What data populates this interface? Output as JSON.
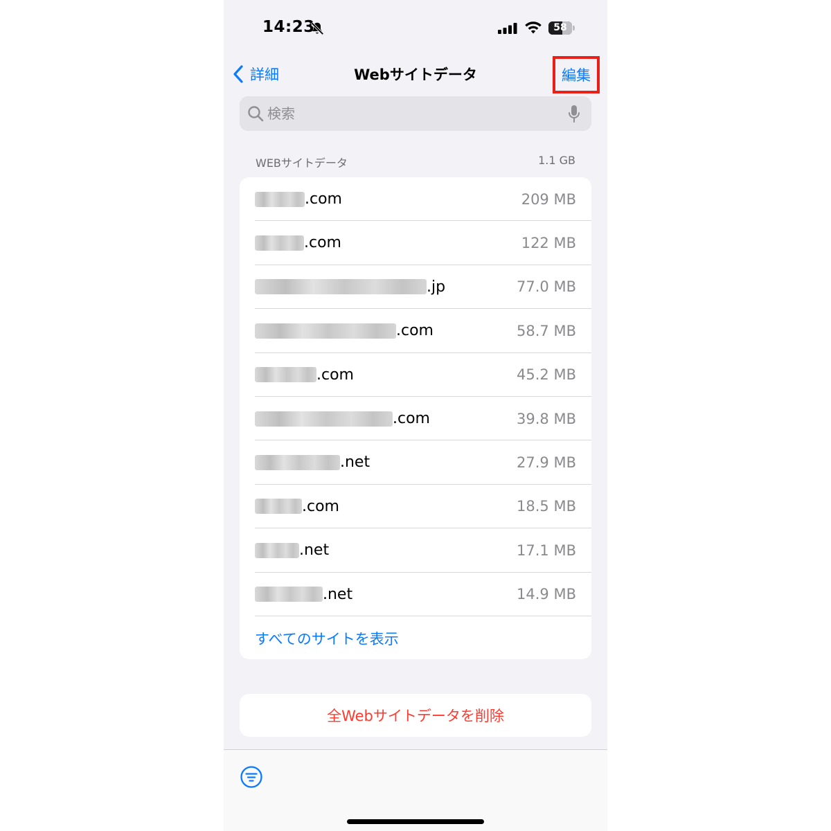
{
  "status_bar": {
    "time": "14:23",
    "battery": "58",
    "battery_level": 0.58
  },
  "nav": {
    "back_label": "詳細",
    "title": "Webサイトデータ",
    "edit_label": "編集"
  },
  "search": {
    "placeholder": "検索"
  },
  "section": {
    "title": "WEBサイトデータ",
    "total": "1.1 GB"
  },
  "sites": [
    {
      "suffix": ".com",
      "size": "209 MB"
    },
    {
      "suffix": ".com",
      "size": "122 MB"
    },
    {
      "suffix": ".jp",
      "size": "77.0 MB"
    },
    {
      "suffix": ".com",
      "size": "58.7 MB"
    },
    {
      "suffix": ".com",
      "size": "45.2 MB"
    },
    {
      "suffix": ".com",
      "size": "39.8 MB"
    },
    {
      "suffix": ".net",
      "size": "27.9 MB"
    },
    {
      "suffix": ".com",
      "size": "18.5 MB"
    },
    {
      "suffix": ".net",
      "size": "17.1 MB"
    },
    {
      "suffix": ".net",
      "size": "14.9 MB"
    }
  ],
  "show_all_label": "すべてのサイトを表示",
  "delete_all_label": "全Webサイトデータを削除",
  "colors": {
    "accent": "#0a7aff",
    "destructive": "#ff3b30",
    "highlight_box": "#e8201a",
    "background": "#f2f2f7"
  },
  "icons": [
    "bell-slash-icon",
    "cellular-signal-icon",
    "wifi-icon",
    "battery-icon",
    "chevron-left-icon",
    "search-icon",
    "microphone-icon",
    "filter-icon"
  ]
}
